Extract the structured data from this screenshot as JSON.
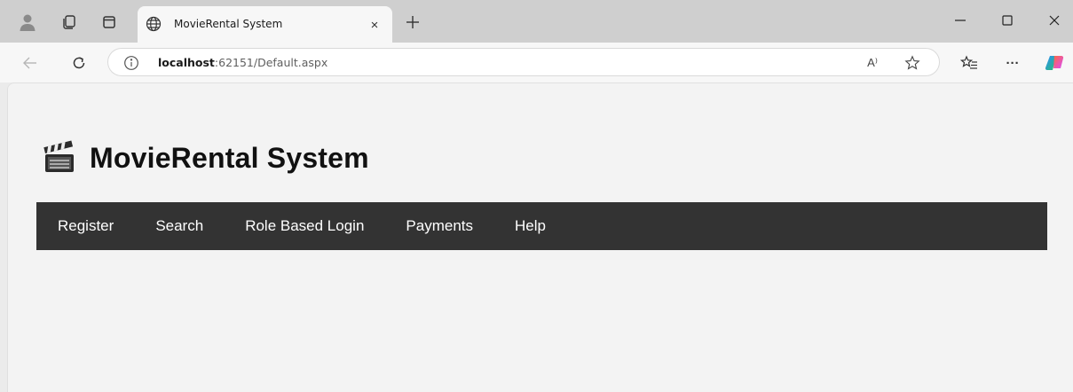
{
  "browser": {
    "tab": {
      "title": "MovieRental System",
      "close_glyph": "×"
    },
    "new_tab_glyph": "+",
    "window_controls": {
      "minimize": "—",
      "maximize": "☐",
      "close": "✕"
    },
    "address": {
      "host": "localhost",
      "rest": ":62151/Default.aspx"
    },
    "toolbar": {
      "more": "···",
      "read_aloud": "A⁾"
    }
  },
  "page": {
    "site_title": "MovieRental System",
    "nav": [
      {
        "label": "Register"
      },
      {
        "label": "Search"
      },
      {
        "label": "Role Based Login"
      },
      {
        "label": "Payments"
      },
      {
        "label": "Help"
      }
    ]
  },
  "colors": {
    "navbar_bg": "#333333",
    "nav_text": "#ffffff",
    "page_bg": "#f3f3f3",
    "tabstrip_bg": "#cfcfcf"
  }
}
